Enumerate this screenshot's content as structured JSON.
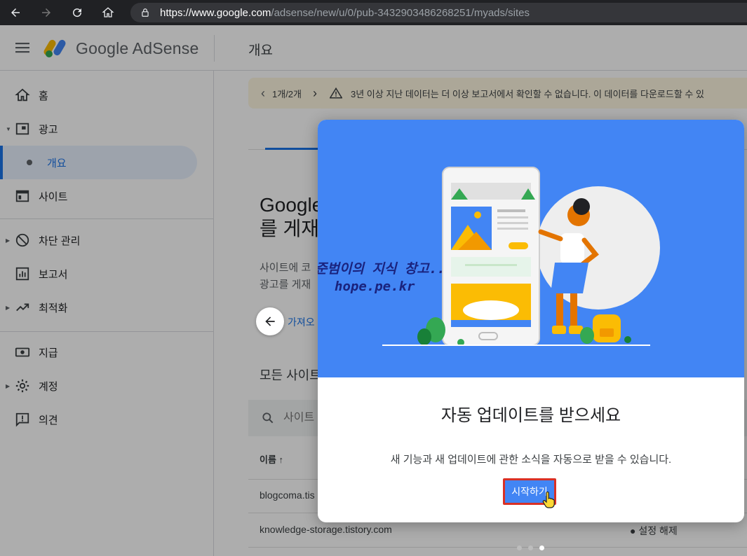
{
  "browser": {
    "url_host": "https://www.google.com",
    "url_path": "/adsense/new/u/0/pub-3432903486268251/myads/sites"
  },
  "header": {
    "brand": "Google AdSense",
    "page_title": "개요"
  },
  "sidebar": {
    "items": [
      {
        "label": "홈",
        "icon": "home-icon"
      },
      {
        "label": "광고",
        "icon": "ads-icon"
      },
      {
        "label": "개요",
        "icon": "dot-icon"
      },
      {
        "label": "사이트",
        "icon": "sites-icon"
      },
      {
        "label": "차단 관리",
        "icon": "block-icon"
      },
      {
        "label": "보고서",
        "icon": "reports-icon"
      },
      {
        "label": "최적화",
        "icon": "optimize-icon"
      },
      {
        "label": "지급",
        "icon": "payments-icon"
      },
      {
        "label": "계정",
        "icon": "gear-icon"
      },
      {
        "label": "의견",
        "icon": "feedback-icon"
      }
    ]
  },
  "notice": {
    "count": "1개/2개",
    "message": "3년 이상 지난 데이터는 더 이상 보고서에서 확인할 수 없습니다. 이 데이터를 다운로드할 수 있"
  },
  "main": {
    "title_line1": "Google",
    "title_line2": "를 게재",
    "body_line1": "사이트에 코",
    "body_line2": "광고를 게재",
    "import_link": "가져오",
    "all_sites": "모든 사이트",
    "search_placeholder": "사이트",
    "col_name": "이름 ↑",
    "rows": [
      {
        "name": "blogcoma.tis",
        "status": ""
      },
      {
        "name": "knowledge-storage.tistory.com",
        "status": "● 설정 해제"
      }
    ]
  },
  "dialog": {
    "watermark_line1": "준범이의 지식 창고..",
    "watermark_line2": "hope.pe.kr",
    "title": "자동 업데이트를 받으세요",
    "text": "새 기능과 새 업데이트에 관한 소식을 자동으로 받을 수 있습니다.",
    "start_button": "시작하기"
  },
  "colors": {
    "accent": "#1a73e8",
    "hero_bg": "#4285f4",
    "highlight_border": "#d93025"
  }
}
